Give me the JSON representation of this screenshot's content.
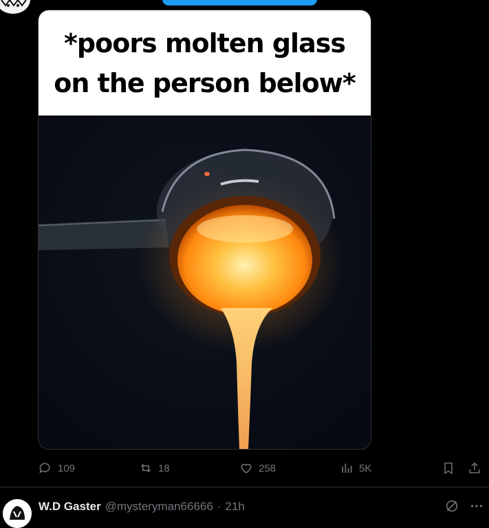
{
  "post": {
    "meme_caption": [
      "*poors molten glass",
      "on the person below*"
    ],
    "stats": {
      "replies": "109",
      "reposts": "18",
      "likes": "258",
      "views": "5K"
    }
  },
  "reply": {
    "name": "W.D Gaster",
    "handle": "@mysteryman66666",
    "separator": "·",
    "time": "21h"
  },
  "colors": {
    "background": "#000000",
    "muted": "#71767b",
    "accent": "#1d9bf0",
    "divider": "#2f3336"
  },
  "icons": [
    "reply-icon",
    "repost-icon",
    "like-icon",
    "views-icon",
    "bookmark-icon",
    "share-icon",
    "grok-icon",
    "more-icon"
  ]
}
